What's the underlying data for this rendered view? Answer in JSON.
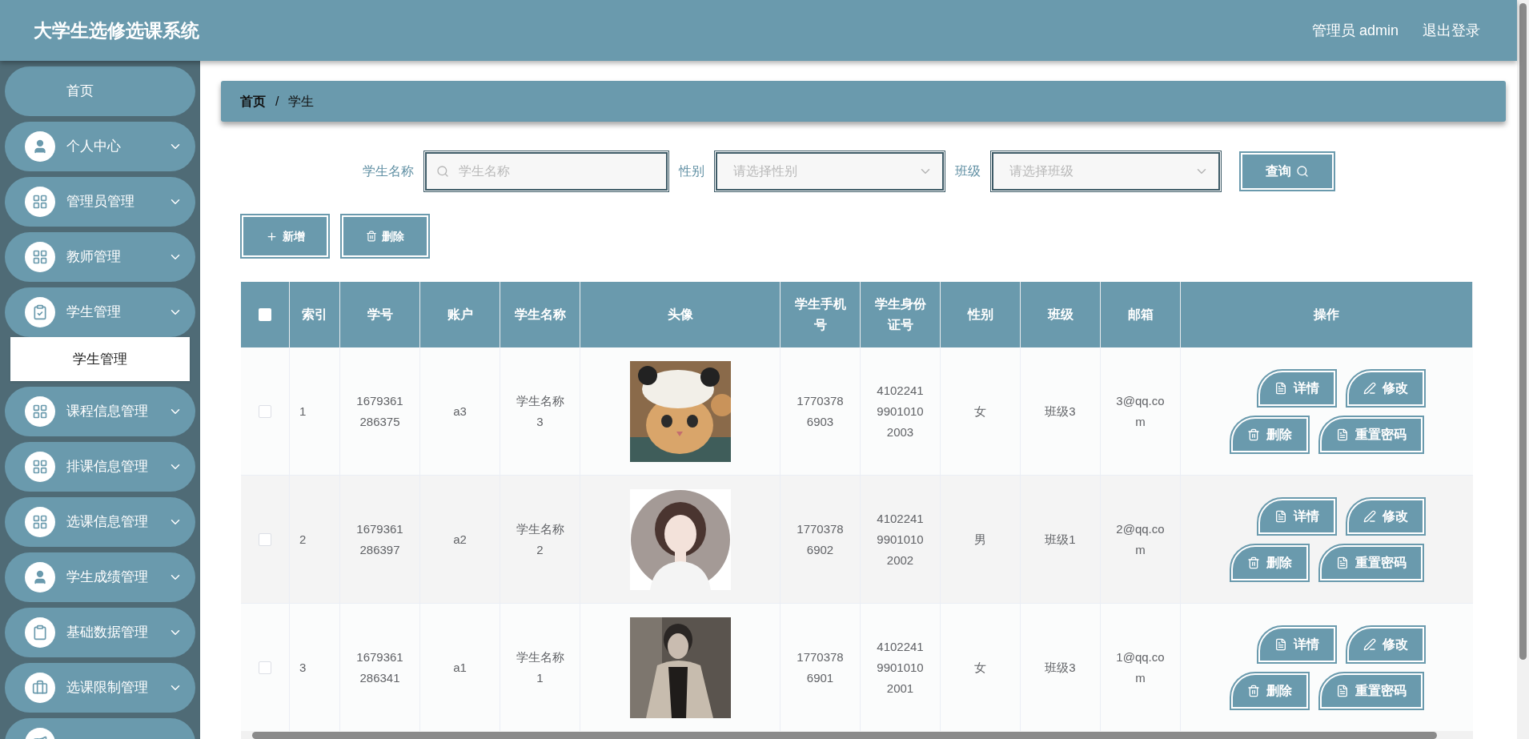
{
  "header": {
    "title": "大学生选修选课系统",
    "user": "管理员 admin",
    "logout": "退出登录"
  },
  "sidebar": {
    "items": [
      {
        "label": "首页",
        "selected": false
      },
      {
        "label": "个人中心",
        "selected": false
      },
      {
        "label": "管理员管理",
        "selected": false
      },
      {
        "label": "教师管理",
        "selected": false
      },
      {
        "label": "学生管理",
        "selected": false,
        "children": [
          {
            "label": "学生管理",
            "selected": true
          }
        ]
      },
      {
        "label": "课程信息管理",
        "selected": false
      },
      {
        "label": "排课信息管理",
        "selected": false
      },
      {
        "label": "选课信息管理",
        "selected": false
      },
      {
        "label": "学生成绩管理",
        "selected": false
      },
      {
        "label": "基础数据管理",
        "selected": false
      },
      {
        "label": "选课限制管理",
        "selected": false
      },
      {
        "selected": false
      }
    ]
  },
  "breadcrumb": [
    "首页",
    "/",
    "学生"
  ],
  "search": {
    "fields": [
      {
        "kind": "input",
        "label": "学生名称",
        "placeholder": "学生名称"
      },
      {
        "kind": "select",
        "label": "性别",
        "placeholder": "请选择性别"
      },
      {
        "kind": "select",
        "label": "班级",
        "placeholder": "请选择班级"
      }
    ],
    "button": "查询"
  },
  "actions": [
    {
      "kind": "add",
      "label": "新增"
    },
    {
      "kind": "delete",
      "label": "删除"
    }
  ],
  "table": {
    "select_all": {
      "checked": false
    },
    "columns": [
      "索引",
      "学号",
      "账户",
      "学生名称",
      "头像",
      "学生手机号",
      "学生身份证号",
      "性别",
      "班级",
      "邮箱",
      "操作"
    ],
    "rows": [
      {
        "checked": false,
        "cells": [
          "1",
          "1679361286375",
          "a3",
          "学生名称3",
          {
            "kind": "picture"
          },
          "17703786903",
          "410224199010102003",
          "女",
          "班级3",
          "3@qq.com"
        ],
        "actions": [
          {
            "kind": "detail",
            "label": "详情"
          },
          {
            "kind": "edit",
            "label": "修改"
          },
          {
            "kind": "delete",
            "label": "删除"
          },
          {
            "kind": "reset",
            "label": "重置密码"
          }
        ]
      },
      {
        "checked": false,
        "cells": [
          "2",
          "1679361286397",
          "a2",
          "学生名称2",
          {
            "kind": "picture"
          },
          "17703786902",
          "410224199010102002",
          "男",
          "班级1",
          "2@qq.com"
        ],
        "actions": [
          {
            "kind": "detail",
            "label": "详情"
          },
          {
            "kind": "edit",
            "label": "修改"
          },
          {
            "kind": "delete",
            "label": "删除"
          },
          {
            "kind": "reset",
            "label": "重置密码"
          }
        ]
      },
      {
        "checked": false,
        "cells": [
          "3",
          "1679361286341",
          "a1",
          "学生名称1",
          {
            "kind": "picture"
          },
          "17703786901",
          "410224199010102001",
          "女",
          "班级3",
          "1@qq.com"
        ],
        "actions": [
          {
            "kind": "detail",
            "label": "详情"
          },
          {
            "kind": "edit",
            "label": "修改"
          },
          {
            "kind": "delete",
            "label": "删除"
          },
          {
            "kind": "reset",
            "label": "重置密码"
          }
        ]
      }
    ]
  }
}
